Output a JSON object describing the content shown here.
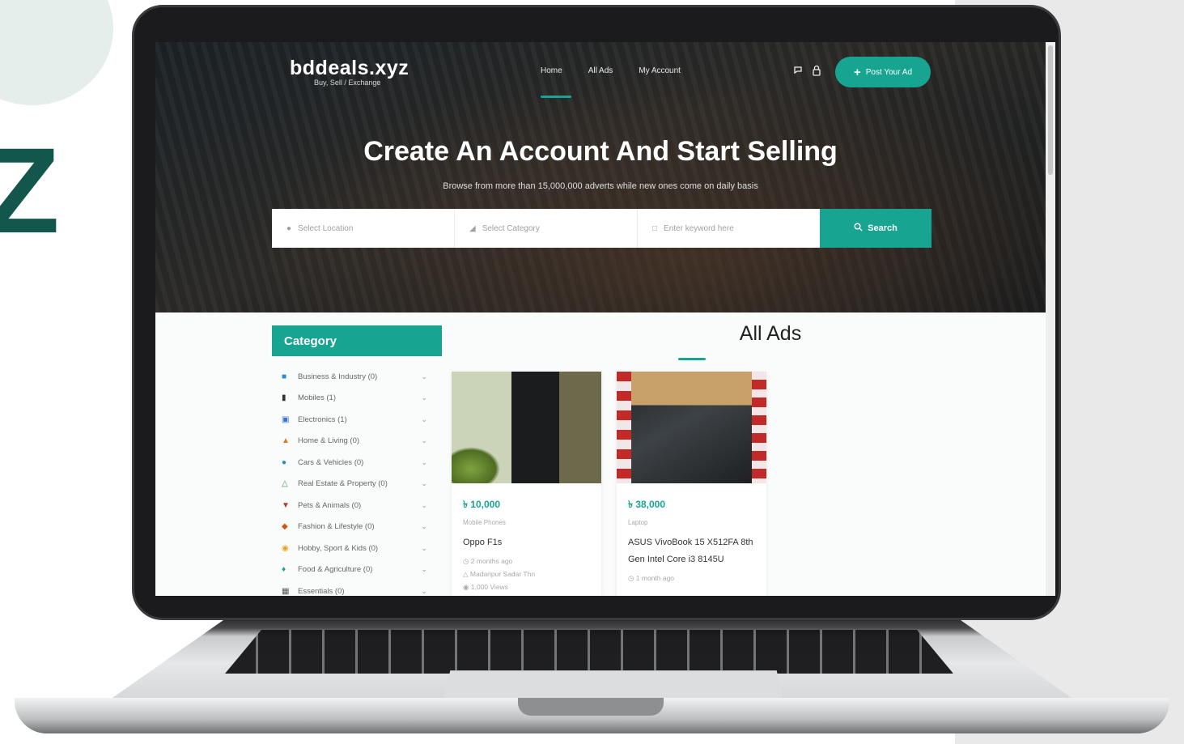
{
  "backdrop": {
    "letter": "Z"
  },
  "site": {
    "name": "bddeals.xyz",
    "tagline": "Buy, Sell / Exchange"
  },
  "nav": {
    "items": [
      "Home",
      "All Ads",
      "My Account"
    ]
  },
  "header": {
    "post_ad_label": "Post Your Ad"
  },
  "hero": {
    "title": "Create An Account And Start Selling",
    "subtitle": "Browse from more than 15,000,000 adverts while new ones come on daily basis"
  },
  "search": {
    "location_placeholder": "Select Location",
    "category_placeholder": "Select Category",
    "keyword_placeholder": "Enter keyword here",
    "button_label": "Search"
  },
  "sidebar": {
    "title": "Category",
    "items": [
      {
        "label": "Business & Industry (0)",
        "icon": "briefcase-icon",
        "color": "#2a8ad6"
      },
      {
        "label": "Mobiles (1)",
        "icon": "phone-icon",
        "color": "#333333"
      },
      {
        "label": "Electronics (1)",
        "icon": "monitor-icon",
        "color": "#3b6fd1"
      },
      {
        "label": "Home & Living (0)",
        "icon": "home-icon",
        "color": "#e07b22"
      },
      {
        "label": "Cars & Vehicles (0)",
        "icon": "car-icon",
        "color": "#1c8fc2"
      },
      {
        "label": "Real Estate & Property (0)",
        "icon": "building-icon",
        "color": "#3aa35a"
      },
      {
        "label": "Pets & Animals (0)",
        "icon": "paw-icon",
        "color": "#c0392b"
      },
      {
        "label": "Fashion & Lifestyle (0)",
        "icon": "shirt-icon",
        "color": "#d35400"
      },
      {
        "label": "Hobby, Sport & Kids (0)",
        "icon": "ball-icon",
        "color": "#e8a317"
      },
      {
        "label": "Food & Agriculture (0)",
        "icon": "leaf-icon",
        "color": "#17a592"
      },
      {
        "label": "Essentials (0)",
        "icon": "basket-icon",
        "color": "#555555"
      }
    ]
  },
  "ads": {
    "title": "All Ads",
    "cards": [
      {
        "price": "৳ 10,000",
        "category": "Mobile Phones",
        "title": "Oppo F1s",
        "time": "2 months ago",
        "location": "Madaripur Sadar Thn",
        "views": "1,000 Views"
      },
      {
        "price": "৳ 38,000",
        "category": "Laptop",
        "title": "ASUS VivoBook 15 X512FA 8th Gen Intel Core i3 8145U",
        "time": "1 month ago",
        "location": "",
        "views": ""
      }
    ]
  },
  "colors": {
    "accent": "#17a592",
    "hero_dark": "#1c2226",
    "backdrop_letter": "#13574c"
  }
}
